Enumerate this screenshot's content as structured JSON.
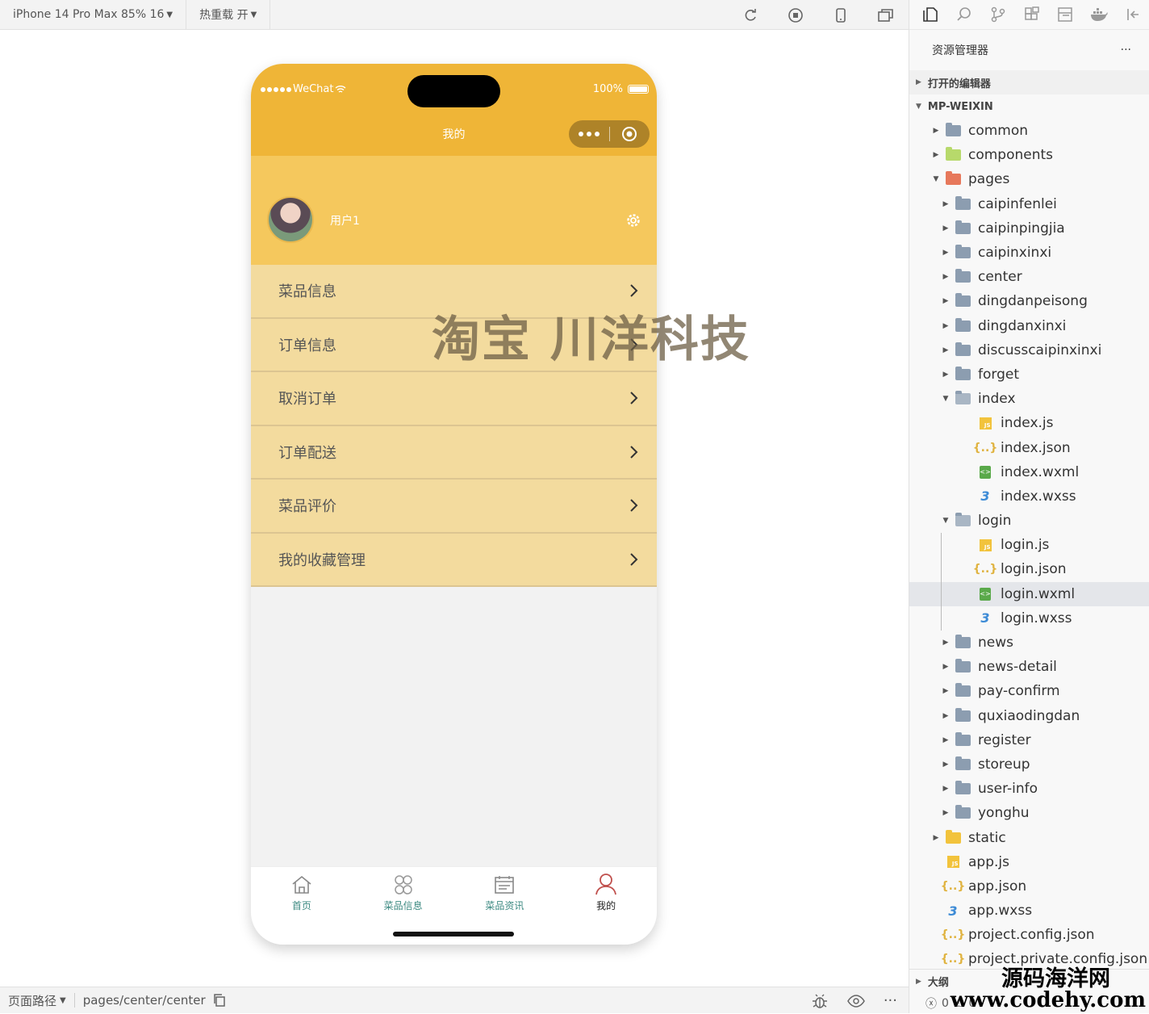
{
  "toolbar": {
    "device_label": "iPhone 14 Pro Max 85% 16",
    "hot_reload_label": "热重载 开"
  },
  "phone": {
    "status": {
      "carrier": "WeChat",
      "battery": "100%"
    },
    "nav_title": "我的",
    "user": {
      "name": "用户1"
    },
    "menu": [
      {
        "label": "菜品信息"
      },
      {
        "label": "订单信息"
      },
      {
        "label": "取消订单"
      },
      {
        "label": "订单配送"
      },
      {
        "label": "菜品评价"
      },
      {
        "label": "我的收藏管理"
      }
    ],
    "tabs": [
      {
        "label": "首页",
        "icon": "home-icon"
      },
      {
        "label": "菜品信息",
        "icon": "grid-icon"
      },
      {
        "label": "菜品资讯",
        "icon": "news-icon"
      },
      {
        "label": "我的",
        "icon": "user-icon",
        "active": true
      }
    ],
    "watermark": "淘宝 川洋科技"
  },
  "explorer": {
    "title": "资源管理器",
    "more": "···",
    "open_editors": "打开的编辑器",
    "root": "MP-WEIXIN",
    "tree": [
      {
        "label": "common",
        "type": "folder",
        "depth": 1,
        "arrow": "▸"
      },
      {
        "label": "components",
        "type": "folder-comp",
        "depth": 1,
        "arrow": "▸"
      },
      {
        "label": "pages",
        "type": "folder-pages",
        "depth": 1,
        "arrow": "▾"
      },
      {
        "label": "caipinfenlei",
        "type": "folder",
        "depth": 2,
        "arrow": "▸"
      },
      {
        "label": "caipinpingjia",
        "type": "folder",
        "depth": 2,
        "arrow": "▸"
      },
      {
        "label": "caipinxinxi",
        "type": "folder",
        "depth": 2,
        "arrow": "▸"
      },
      {
        "label": "center",
        "type": "folder",
        "depth": 2,
        "arrow": "▸"
      },
      {
        "label": "dingdanpeisong",
        "type": "folder",
        "depth": 2,
        "arrow": "▸"
      },
      {
        "label": "dingdanxinxi",
        "type": "folder",
        "depth": 2,
        "arrow": "▸"
      },
      {
        "label": "discusscaipinxinxi",
        "type": "folder",
        "depth": 2,
        "arrow": "▸"
      },
      {
        "label": "forget",
        "type": "folder",
        "depth": 2,
        "arrow": "▸"
      },
      {
        "label": "index",
        "type": "folder-open",
        "depth": 2,
        "arrow": "▾"
      },
      {
        "label": "index.js",
        "type": "js",
        "depth": 3,
        "arrow": ""
      },
      {
        "label": "index.json",
        "type": "json",
        "depth": 3,
        "arrow": ""
      },
      {
        "label": "index.wxml",
        "type": "wxml",
        "depth": 3,
        "arrow": ""
      },
      {
        "label": "index.wxss",
        "type": "wxss",
        "depth": 3,
        "arrow": ""
      },
      {
        "label": "login",
        "type": "folder-open",
        "depth": 2,
        "arrow": "▾"
      },
      {
        "label": "login.js",
        "type": "js",
        "depth": 3,
        "arrow": ""
      },
      {
        "label": "login.json",
        "type": "json",
        "depth": 3,
        "arrow": ""
      },
      {
        "label": "login.wxml",
        "type": "wxml",
        "depth": 3,
        "arrow": "",
        "selected": true
      },
      {
        "label": "login.wxss",
        "type": "wxss",
        "depth": 3,
        "arrow": ""
      },
      {
        "label": "news",
        "type": "folder",
        "depth": 2,
        "arrow": "▸"
      },
      {
        "label": "news-detail",
        "type": "folder",
        "depth": 2,
        "arrow": "▸"
      },
      {
        "label": "pay-confirm",
        "type": "folder",
        "depth": 2,
        "arrow": "▸"
      },
      {
        "label": "quxiaodingdan",
        "type": "folder",
        "depth": 2,
        "arrow": "▸"
      },
      {
        "label": "register",
        "type": "folder",
        "depth": 2,
        "arrow": "▸"
      },
      {
        "label": "storeup",
        "type": "folder",
        "depth": 2,
        "arrow": "▸"
      },
      {
        "label": "user-info",
        "type": "folder",
        "depth": 2,
        "arrow": "▸"
      },
      {
        "label": "yonghu",
        "type": "folder",
        "depth": 2,
        "arrow": "▸"
      },
      {
        "label": "static",
        "type": "folder-static",
        "depth": 1,
        "arrow": "▸"
      },
      {
        "label": "app.js",
        "type": "js",
        "depth": 1,
        "arrow": ""
      },
      {
        "label": "app.json",
        "type": "json",
        "depth": 1,
        "arrow": ""
      },
      {
        "label": "app.wxss",
        "type": "wxss",
        "depth": 1,
        "arrow": ""
      },
      {
        "label": "project.config.json",
        "type": "json",
        "depth": 1,
        "arrow": ""
      },
      {
        "label": "project.private.config.json",
        "type": "json",
        "depth": 1,
        "arrow": ""
      }
    ],
    "outline": "大纲",
    "errors": "0",
    "warnings": "0"
  },
  "bottom": {
    "page_path_label": "页面路径",
    "page_path": "pages/center/center"
  },
  "site_watermark": {
    "line1": "源码海洋网",
    "line2": "www.codehy.com"
  },
  "colors": {
    "accent": "#efb537",
    "header": "#f5c85d",
    "menu": "#f3db9e",
    "tab_text": "#3d8a82"
  }
}
